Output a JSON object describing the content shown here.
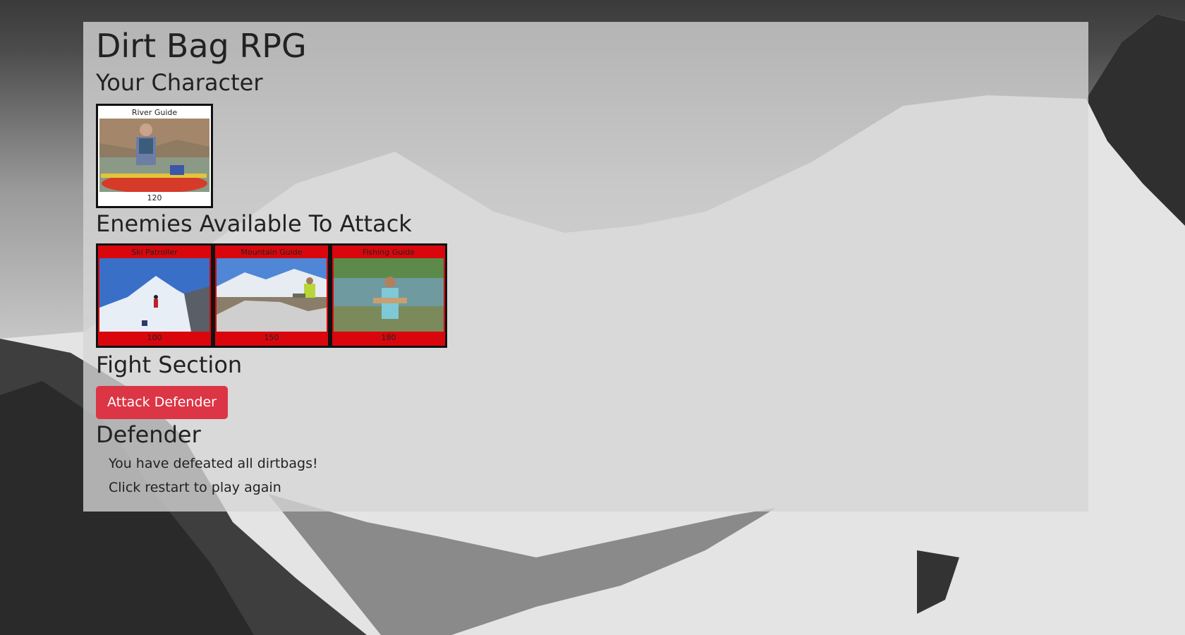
{
  "app": {
    "title": "Dirt Bag RPG"
  },
  "your_character": {
    "heading": "Your Character",
    "card": {
      "name": "River Guide",
      "hp": "120",
      "image": "river-guide-photo"
    }
  },
  "enemies": {
    "heading": "Enemies Available To Attack",
    "cards": [
      {
        "name": "Ski Patroller",
        "hp": "100",
        "image": "ski-patroller-photo"
      },
      {
        "name": "Mountain Guide",
        "hp": "150",
        "image": "mountain-guide-photo"
      },
      {
        "name": "Fishing Guide",
        "hp": "180",
        "image": "fishing-guide-photo"
      }
    ]
  },
  "fight": {
    "heading": "Fight Section",
    "attack_label": "Attack Defender"
  },
  "defender": {
    "heading": "Defender",
    "messages": [
      "You have defeated all dirtbags!",
      "Click restart to play again"
    ]
  },
  "colors": {
    "enemy_card": "#d9070d",
    "attack_button": "#dc3545"
  }
}
